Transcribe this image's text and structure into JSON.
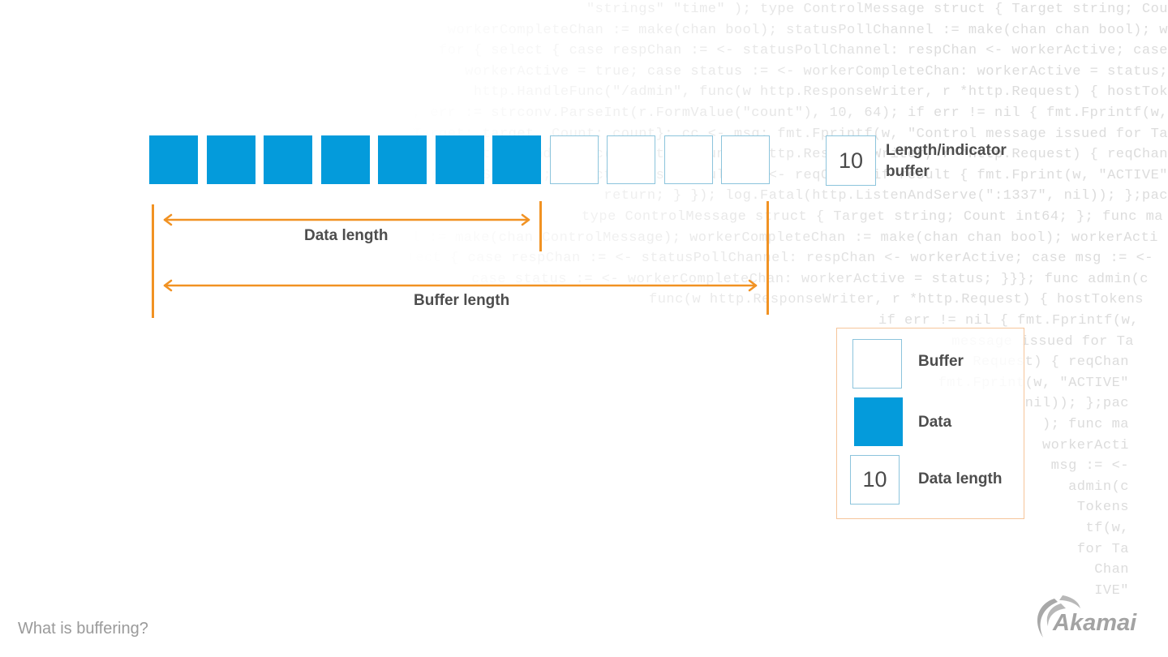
{
  "background_code": [
    "\"strings\" \"time\" ); type ControlMessage struct { Target string; Cou",
    "workerCompleteChan := make(chan bool); statusPollChannel := make(chan chan bool); w",
    "for { select { case respChan := <- statusPollChannel: respChan <- workerActive; case",
    "workerActive = true; case status := <- workerCompleteChan: workerActive = status;",
    "http.HandleFunc(\"/admin\", func(w http.ResponseWriter, r *http.Request) { hostTok",
    "count, err := strconv.ParseInt(r.FormValue(\"count\"), 10, 64); if err != nil { fmt.Fprintf(w,",
    "msg := ControlMessage{Target: target, Count: count}; cc <- msg; fmt.Fprintf(w, \"Control message issued for Ta",
    "http.HandleFunc(\"/status\",func(w http.ResponseWriter, r *http.Request) { reqChan",
    "timeout := time.After(time.Second); select { case result := <- reqChan: if result { fmt.Fprint(w, \"ACTIVE\"",
    "return; } }); log.Fatal(http.ListenAndServe(\":1337\", nil)); };pac",
    "type ControlMessage struct { Target string; Count int64; }; func ma",
    "controlChannel := make(chan ControlMessage); workerCompleteChan := make(chan chan bool); workerActi",
    "for { select { case respChan := <- statusPollChannel: respChan <- workerActive; case msg := <-",
    "case status := <- workerCompleteChan: workerActive = status; }}}; func admin(c",
    "func(w http.ResponseWriter, r *http.Request) { hostTokens",
    "if err != nil { fmt.Fprintf(w,",
    "message issued for Ta",
    "Request) { reqChan",
    "fmt.Fprint(w, \"ACTIVE\"",
    "nil)); };pac",
    "); func ma",
    "workerActi",
    "msg := <-",
    "admin(c",
    "Tokens",
    "tf(w,",
    "for Ta",
    "Chan",
    "IVE\""
  ],
  "buffer": {
    "total_cells": 11,
    "data_cells": 7,
    "indicator_value": "10",
    "indicator_label_line1": "Length/indicator",
    "indicator_label_line2": "buffer",
    "data_length_label": "Data length",
    "buffer_length_label": "Buffer length"
  },
  "legend": {
    "items": [
      {
        "swatch": "buffer",
        "label": "Buffer"
      },
      {
        "swatch": "data",
        "label": "Data"
      },
      {
        "swatch": "length",
        "value": "10",
        "label": "Data length"
      }
    ]
  },
  "footer": {
    "title": "What is buffering?",
    "logo_text": "Akamai"
  },
  "colors": {
    "data_fill": "#049bdb",
    "buffer_border": "#8cc4dc",
    "marker_orange": "#f19223",
    "legend_border": "#f6c59a",
    "text_dark": "#4d4d4d",
    "footer_gray": "#9a9a9a"
  }
}
